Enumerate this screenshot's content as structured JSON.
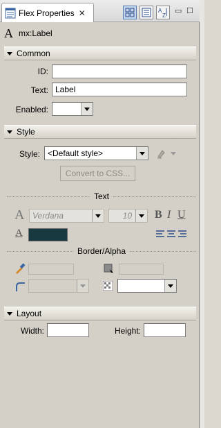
{
  "tab": {
    "title": "Flex Properties",
    "close_icon": "close-icon"
  },
  "toolbar": {
    "buttons": [
      "standard-view-icon",
      "category-view-icon",
      "alphabetical-view-icon"
    ]
  },
  "window_controls": {
    "minimize": "▭",
    "maximize": "☐"
  },
  "component": {
    "icon": "A",
    "type": "mx:Label"
  },
  "common": {
    "title": "Common",
    "id_label": "ID:",
    "id_value": "",
    "text_label": "Text:",
    "text_value": "Label",
    "enabled_label": "Enabled:",
    "enabled_value": ""
  },
  "style": {
    "title": "Style",
    "style_label": "Style:",
    "style_value": "<Default style>",
    "convert_button": "Convert to CSS..."
  },
  "text_group": {
    "title": "Text",
    "font_value": "Verdana",
    "size_value": "10",
    "bold_label": "B",
    "italic_label": "I",
    "underline_label": "U",
    "color_hex": "#17393f"
  },
  "border_group": {
    "title": "Border/Alpha"
  },
  "layout": {
    "title": "Layout",
    "width_label": "Width:",
    "width_value": "",
    "height_label": "Height:",
    "height_value": ""
  }
}
